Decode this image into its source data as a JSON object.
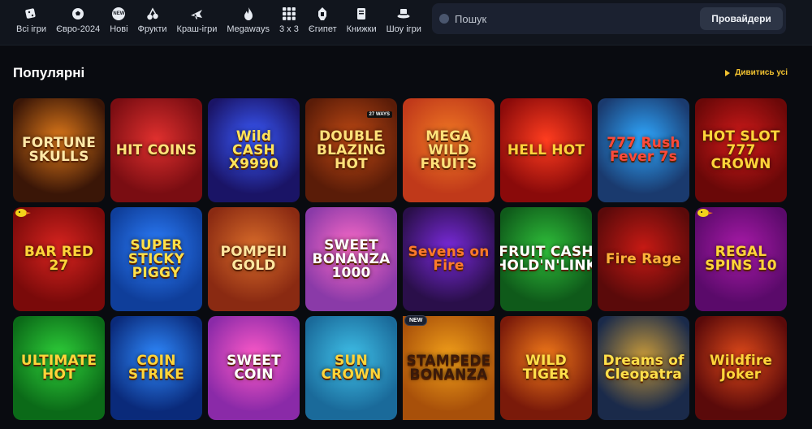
{
  "categories": [
    {
      "label": "Всі ігри",
      "icon": "dice-icon"
    },
    {
      "label": "Євро-2024",
      "icon": "football-icon"
    },
    {
      "label": "Нові",
      "icon": "new-badge-icon",
      "icon_text": "NEW"
    },
    {
      "label": "Фрукти",
      "icon": "cherry-icon"
    },
    {
      "label": "Краш-ігри",
      "icon": "airplane-icon"
    },
    {
      "label": "Megaways",
      "icon": "flame-icon"
    },
    {
      "label": "3 x 3",
      "icon": "grid-icon"
    },
    {
      "label": "Єгипет",
      "icon": "pharaoh-icon"
    },
    {
      "label": "Книжки",
      "icon": "book-icon"
    },
    {
      "label": "Шоу ігри",
      "icon": "show-hat-icon"
    }
  ],
  "search": {
    "placeholder": "Пошук",
    "providers_label": "Провайдери"
  },
  "section": {
    "title": "Популярні",
    "see_all": "Дивитись усі"
  },
  "games": [
    {
      "name": "FORTUNE SKULLS",
      "bg": "#3a1607",
      "accent": "#e07a1a",
      "text": "#ffe9a8"
    },
    {
      "name": "HIT COINS",
      "bg": "#7a0d12",
      "accent": "#e0302e",
      "text": "#ffe37a"
    },
    {
      "name": "Wild CASH X9990",
      "bg": "#1a1466",
      "accent": "#3b5bff",
      "text": "#ffe45a"
    },
    {
      "name": "DOUBLE BLAZING HOT",
      "bg": "#5a1c08",
      "accent": "#c14a14",
      "text": "#ffe27a",
      "tag": "27 WAYS"
    },
    {
      "name": "MEGA WILD FRUITS",
      "bg": "#c0391a",
      "accent": "#f27a24",
      "text": "#ffe27a"
    },
    {
      "name": "HELL HOT",
      "bg": "#8a0a0a",
      "accent": "#ff3d1f",
      "text": "#ffd23a"
    },
    {
      "name": "777 Rush Fever 7s",
      "bg": "#1a3a6e",
      "accent": "#2fa8ff",
      "text": "#ff4a3a"
    },
    {
      "name": "HOT SLOT 777 CROWN",
      "bg": "#6a0808",
      "accent": "#d11a1a",
      "text": "#ffd53a"
    },
    {
      "name": "BAR RED 27",
      "bg": "#7a0a0a",
      "accent": "#d8241f",
      "text": "#ffd53a",
      "mark": "duck"
    },
    {
      "name": "SUPER STICKY PIGGY",
      "bg": "#0f3e9a",
      "accent": "#2d80ff",
      "text": "#ffe04a"
    },
    {
      "name": "POMPEII GOLD",
      "bg": "#8a2a12",
      "accent": "#d96c2a",
      "text": "#ffe7a0"
    },
    {
      "name": "SWEET BONANZA 1000",
      "bg": "#8a3aa8",
      "accent": "#ff6cc8",
      "text": "#ffffff"
    },
    {
      "name": "Sevens on Fire",
      "bg": "#2a0f4a",
      "accent": "#7a2adb",
      "text": "#ff7a2a"
    },
    {
      "name": "FRUIT CASH HOLD'N'LINK",
      "bg": "#0f5a1a",
      "accent": "#2fbf3a",
      "text": "#ffffff"
    },
    {
      "name": "Fire Rage",
      "bg": "#5a0a0a",
      "accent": "#c71a14",
      "text": "#ffb23a"
    },
    {
      "name": "REGAL SPINS 10",
      "bg": "#5a0a6a",
      "accent": "#a81aa8",
      "text": "#ffd53a",
      "mark": "duck"
    },
    {
      "name": "ULTIMATE HOT",
      "bg": "#0b6a18",
      "accent": "#2fd13a",
      "text": "#ffd53a"
    },
    {
      "name": "COIN STRIKE",
      "bg": "#0a2a7a",
      "accent": "#2f8aff",
      "text": "#ffd53a"
    },
    {
      "name": "SWEET COIN",
      "bg": "#8a2aa8",
      "accent": "#ff5ac8",
      "text": "#ffffff"
    },
    {
      "name": "SUN CROWN",
      "bg": "#1a6a9a",
      "accent": "#3fc0e8",
      "text": "#ffd53a"
    },
    {
      "name": "STAMPEDE BONANZA",
      "bg": "#a8500a",
      "accent": "#f2a01a",
      "text": "#3a1a0a",
      "badge": "NEW"
    },
    {
      "name": "WILD TIGER",
      "bg": "#7a1a0a",
      "accent": "#f27a1a",
      "text": "#ffe04a"
    },
    {
      "name": "Dreams of Cleopatra",
      "bg": "#1a2a4a",
      "accent": "#c89a3a",
      "text": "#ffe04a"
    },
    {
      "name": "Wildfire Joker",
      "bg": "#5a0a0a",
      "accent": "#e04a1a",
      "text": "#ffd53a"
    }
  ],
  "colors": {
    "accent": "#f2c230",
    "bg": "#090b10",
    "topbar": "#11151d"
  }
}
